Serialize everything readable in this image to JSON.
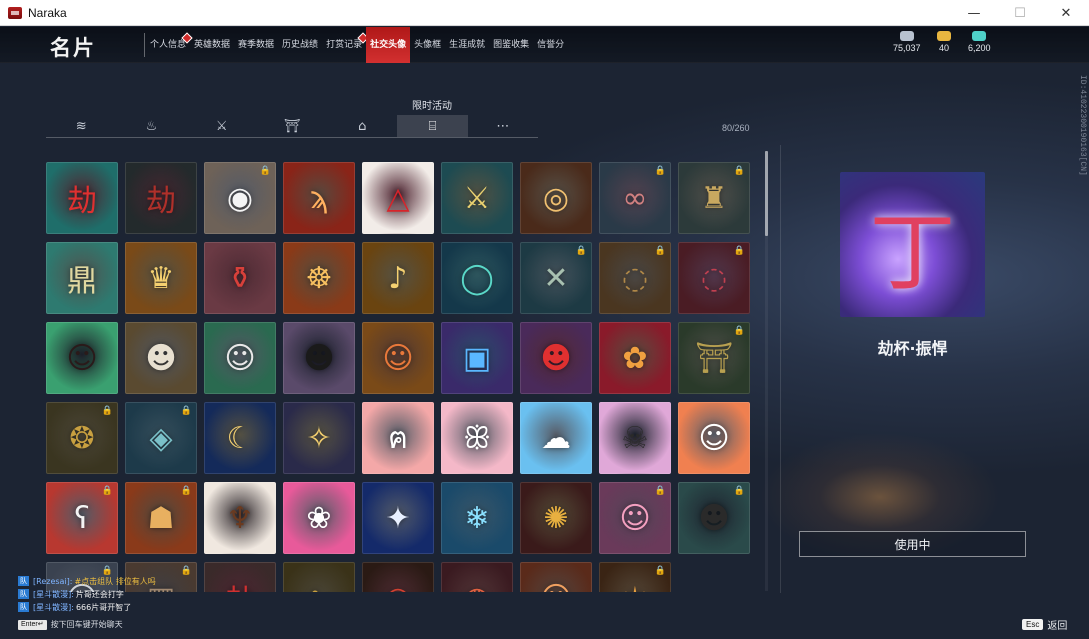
{
  "window": {
    "title": "Naraka",
    "minimize": "—",
    "maximize": "☐",
    "close": "✕"
  },
  "header": {
    "title": "名片",
    "tabs": [
      {
        "label": "个人信息",
        "active": false,
        "badge": true
      },
      {
        "label": "英雄数据",
        "active": false,
        "badge": false
      },
      {
        "label": "赛季数据",
        "active": false,
        "badge": false
      },
      {
        "label": "历史战绩",
        "active": false,
        "badge": false
      },
      {
        "label": "打赏记录",
        "active": false,
        "badge": true
      },
      {
        "label": "社交头像",
        "active": true,
        "badge": false
      },
      {
        "label": "头像框",
        "active": false,
        "badge": false
      },
      {
        "label": "生涯成就",
        "active": false,
        "badge": false
      },
      {
        "label": "图鉴收集",
        "active": false,
        "badge": false
      },
      {
        "label": "信誉分",
        "active": false,
        "badge": false
      }
    ],
    "currencies": [
      {
        "icon": "coin-pile-icon",
        "value": "75,037",
        "color": "#b8c2d0"
      },
      {
        "icon": "gold-ticket-icon",
        "value": "40",
        "color": "#e8b640"
      },
      {
        "icon": "feather-gem-icon",
        "value": "6,200",
        "color": "#4fd0c8"
      }
    ]
  },
  "category": {
    "hover_label": "限时活动",
    "tabs": [
      {
        "icon": "layers-icon",
        "glyph": "≋"
      },
      {
        "icon": "flame-icon",
        "glyph": "♨"
      },
      {
        "icon": "sword-icon",
        "glyph": "⚔"
      },
      {
        "icon": "gift-box-icon",
        "glyph": "⛩"
      },
      {
        "icon": "treasure-chest-icon",
        "glyph": "⌂"
      },
      {
        "icon": "present-icon",
        "glyph": "⌸"
      },
      {
        "icon": "more-dots-icon",
        "glyph": "⋯"
      }
    ],
    "active_index": 5,
    "count": "80/260"
  },
  "side_id": "ID:410223001901​63[CN]",
  "avatars": [
    {
      "name": "red-calligraphy-avatar",
      "glyph": "劫",
      "bg": "#1f6e6a",
      "fg": "#e03030",
      "locked": false
    },
    {
      "name": "dark-red-calligraphy-avatar",
      "glyph": "劫",
      "bg": "#232a2c",
      "fg": "#b0302a",
      "locked": false
    },
    {
      "name": "panda-avatar",
      "glyph": "◉",
      "bg": "#6e6258",
      "fg": "#f4f4f4",
      "locked": true
    },
    {
      "name": "flame-emblem-avatar",
      "glyph": "ϡ",
      "bg": "#8a2418",
      "fg": "#ffb060",
      "locked": false
    },
    {
      "name": "red-triangle-emblem-avatar",
      "glyph": "△",
      "bg": "#f2ece8",
      "fg": "#d8242a",
      "locked": false
    },
    {
      "name": "golden-sword-avatar",
      "glyph": "⚔",
      "bg": "#1d4b52",
      "fg": "#e8d070",
      "locked": false
    },
    {
      "name": "golden-dragon-ring-avatar",
      "glyph": "◎",
      "bg": "#4a2a1a",
      "fg": "#f0c070",
      "locked": false
    },
    {
      "name": "sunglasses-avatar",
      "glyph": "∞",
      "bg": "#2a3a48",
      "fg": "#d08080",
      "locked": true
    },
    {
      "name": "golden-crane-avatar",
      "glyph": "♜",
      "bg": "#2c3a3a",
      "fg": "#c8a860",
      "locked": true
    },
    {
      "name": "bronze-cauldron-avatar",
      "glyph": "鼎",
      "bg": "#2e7a70",
      "fg": "#e0d8a0",
      "locked": false
    },
    {
      "name": "golden-crown-avatar",
      "glyph": "♛",
      "bg": "#7a4a18",
      "fg": "#f4d070",
      "locked": false
    },
    {
      "name": "red-vase-avatar",
      "glyph": "⚱",
      "bg": "#6a3a44",
      "fg": "#d8403a",
      "locked": false
    },
    {
      "name": "compass-emblem-avatar",
      "glyph": "☸",
      "bg": "#8a3a18",
      "fg": "#f8c060",
      "locked": false
    },
    {
      "name": "golden-pipa-avatar",
      "glyph": "♪",
      "bg": "#6a4410",
      "fg": "#f4d070",
      "locked": false
    },
    {
      "name": "jade-ring-avatar",
      "glyph": "◯",
      "bg": "#14384a",
      "fg": "#5ad8c8",
      "locked": false
    },
    {
      "name": "crossed-swords-avatar",
      "glyph": "✕",
      "bg": "#1d3a44",
      "fg": "#a8c0b0",
      "locked": true
    },
    {
      "name": "golden-swirl-avatar",
      "glyph": "◌",
      "bg": "#4a3620",
      "fg": "#b08848",
      "locked": true
    },
    {
      "name": "crimson-swirl-avatar",
      "glyph": "◌",
      "bg": "#4a1c24",
      "fg": "#c04050",
      "locked": true
    },
    {
      "name": "anime-girl-avatar",
      "glyph": "☺",
      "bg": "#3aa070",
      "fg": "#2a1a1a",
      "locked": false
    },
    {
      "name": "white-haired-witcher-avatar",
      "glyph": "☻",
      "bg": "#5a4a30",
      "fg": "#e8e0d0",
      "locked": false
    },
    {
      "name": "silver-haired-woman-avatar",
      "glyph": "☺",
      "bg": "#2a6a50",
      "fg": "#e8e8e8",
      "locked": false
    },
    {
      "name": "dark-haired-woman-avatar",
      "glyph": "☻",
      "bg": "#5a4a6a",
      "fg": "#1a1a1a",
      "locked": false
    },
    {
      "name": "red-haired-woman-avatar",
      "glyph": "☺",
      "bg": "#7a4a18",
      "fg": "#e8783a",
      "locked": false
    },
    {
      "name": "arcade-cabinet-avatar",
      "glyph": "▣",
      "bg": "#3a2a6a",
      "fg": "#5ab8ff",
      "locked": false
    },
    {
      "name": "red-haired-fighter-avatar",
      "glyph": "☻",
      "bg": "#4a2a5a",
      "fg": "#e03030",
      "locked": false
    },
    {
      "name": "red-gift-bow-avatar",
      "glyph": "✿",
      "bg": "#8a1a2a",
      "fg": "#f0a040",
      "locked": false
    },
    {
      "name": "golden-pavilion-avatar",
      "glyph": "⛩",
      "bg": "#2a3a2a",
      "fg": "#b8a050",
      "locked": true
    },
    {
      "name": "golden-seal-avatar",
      "glyph": "❂",
      "bg": "#3a3520",
      "fg": "#c8a040",
      "locked": true
    },
    {
      "name": "blue-diamond-avatar",
      "glyph": "◈",
      "bg": "#1d3a4a",
      "fg": "#7ac0c8",
      "locked": true
    },
    {
      "name": "moon-orb-avatar",
      "glyph": "☾",
      "bg": "#142a5a",
      "fg": "#f4d070",
      "locked": false
    },
    {
      "name": "crystal-flame-avatar",
      "glyph": "✧",
      "bg": "#2a2a4a",
      "fg": "#f4d070",
      "locked": false
    },
    {
      "name": "hello-kitty-avatar",
      "glyph": "ฅ",
      "bg": "#f4a8a8",
      "fg": "#ffffff",
      "locked": false
    },
    {
      "name": "my-melody-avatar",
      "glyph": "ꕥ",
      "bg": "#f4b8c8",
      "fg": "#ffffff",
      "locked": false
    },
    {
      "name": "cinnamoroll-avatar",
      "glyph": "☁",
      "bg": "#6ac0f0",
      "fg": "#ffffff",
      "locked": false
    },
    {
      "name": "kuromi-avatar",
      "glyph": "☠",
      "bg": "#e0a8d8",
      "fg": "#2a2a2a",
      "locked": false
    },
    {
      "name": "lucky-cat-avatar",
      "glyph": "☺",
      "bg": "#f08050",
      "fg": "#ffffff",
      "locked": false
    },
    {
      "name": "polar-bear-avatar",
      "glyph": "ʕ",
      "bg": "#b83830",
      "fg": "#f4f4f4",
      "locked": true
    },
    {
      "name": "mask-warrior-avatar",
      "glyph": "☗",
      "bg": "#8a3a1a",
      "fg": "#e8b060",
      "locked": true
    },
    {
      "name": "bronze-totem-avatar",
      "glyph": "♆",
      "bg": "#f0e8e0",
      "fg": "#6a3a20",
      "locked": false
    },
    {
      "name": "rabbit-lion-avatar",
      "glyph": "❀",
      "bg": "#e85a9a",
      "fg": "#ffffff",
      "locked": false
    },
    {
      "name": "blue-dragon-mask-avatar",
      "glyph": "✦",
      "bg": "#142a6a",
      "fg": "#e8f0ff",
      "locked": false
    },
    {
      "name": "ice-blade-avatar",
      "glyph": "❄",
      "bg": "#1a4a6a",
      "fg": "#8ae0ff",
      "locked": false
    },
    {
      "name": "golden-demon-mask-avatar",
      "glyph": "✺",
      "bg": "#3a1a1a",
      "fg": "#e8b040",
      "locked": false
    },
    {
      "name": "pink-haired-warrior-avatar",
      "glyph": "☺",
      "bg": "#6a3a5a",
      "fg": "#f4a0c0",
      "locked": true
    },
    {
      "name": "green-haired-girl-avatar",
      "glyph": "☻",
      "bg": "#2a4a4a",
      "fg": "#2a2a2a",
      "locked": true
    },
    {
      "name": "silver-figure-avatar",
      "glyph": "☺",
      "bg": "#3a4250",
      "fg": "#d0d4da",
      "locked": true
    },
    {
      "name": "stone-tile-avatar",
      "glyph": "▦",
      "bg": "#4a3a30",
      "fg": "#a08870",
      "locked": true
    },
    {
      "name": "red-calligraphy-2-avatar",
      "glyph": "劫",
      "bg": "#3a2a2a",
      "fg": "#d03030",
      "locked": false
    },
    {
      "name": "dragon-scale-avatar",
      "glyph": "∿",
      "bg": "#3a3218",
      "fg": "#c8a040",
      "locked": false
    },
    {
      "name": "straw-hat-avatar",
      "glyph": "◠",
      "bg": "#2a1a14",
      "fg": "#d04030",
      "locked": false
    },
    {
      "name": "red-lantern-avatar",
      "glyph": "◍",
      "bg": "#3a1a20",
      "fg": "#e06040",
      "locked": false
    },
    {
      "name": "fox-mask-avatar",
      "glyph": "☺",
      "bg": "#5a2a1a",
      "fg": "#f0a060",
      "locked": false
    },
    {
      "name": "golden-dragon-avatar",
      "glyph": "✶",
      "bg": "#3a2414",
      "fg": "#e8a040",
      "locked": true
    }
  ],
  "preview": {
    "glyph": "丁",
    "name": "劫杯·振悍",
    "button": "使用中"
  },
  "chat": {
    "lines": [
      {
        "channel": "队",
        "user": "[Rezesai]:",
        "message": "#点击组队 排位有人吗",
        "highlight": true
      },
      {
        "channel": "队",
        "user": "[星斗散漫]:",
        "message": "片哥还会打字",
        "highlight": false
      },
      {
        "channel": "队",
        "user": "[星斗散漫]:",
        "message": "666片哥开智了",
        "highlight": false
      }
    ],
    "hint_key": "Enter↵",
    "hint_text": "按下回车键开始聊天"
  },
  "footer": {
    "esc_key": "Esc",
    "back_label": "返回"
  }
}
